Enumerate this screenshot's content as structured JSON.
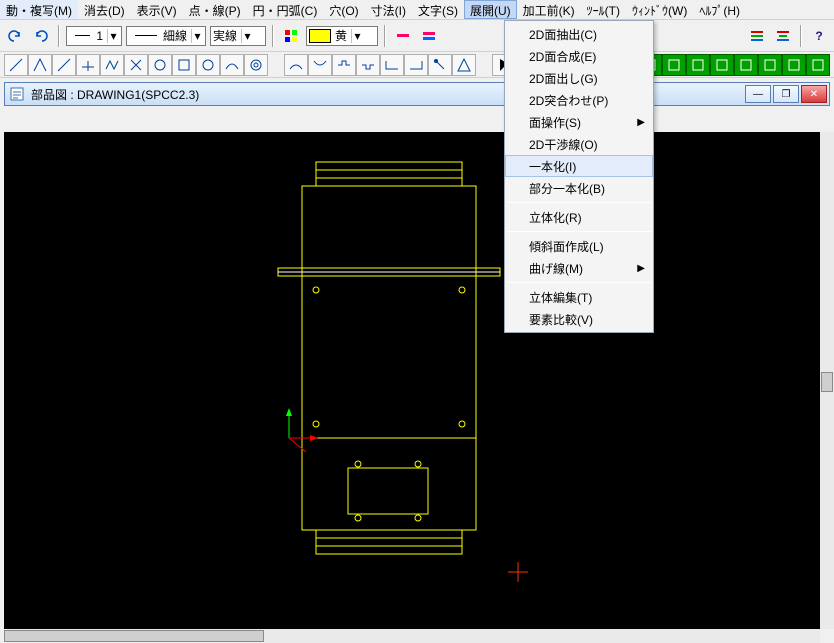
{
  "menubar": [
    {
      "label": "動・複写(M)"
    },
    {
      "label": "消去(D)"
    },
    {
      "label": "表示(V)"
    },
    {
      "label": "点・線(P)"
    },
    {
      "label": "円・円弧(C)"
    },
    {
      "label": "穴(O)"
    },
    {
      "label": "寸法(I)"
    },
    {
      "label": "文字(S)"
    },
    {
      "label": "展開(U)",
      "active": true
    },
    {
      "label": "加工前(K)"
    },
    {
      "label": "ﾂｰﾙ(T)"
    },
    {
      "label": "ｳｨﾝﾄﾞｳ(W)"
    },
    {
      "label": "ﾍﾙﾌﾟ(H)"
    }
  ],
  "toolbar1": {
    "linewidth": "1",
    "linepattern": "細線",
    "linestyle": "実線",
    "color_label": "黄"
  },
  "document": {
    "title": "部品図 : DRAWING1(SPCC2.3)"
  },
  "dropdown": [
    {
      "label": "2D面抽出(C)"
    },
    {
      "label": "2D面合成(E)"
    },
    {
      "label": "2D面出し(G)"
    },
    {
      "label": "2D突合わせ(P)"
    },
    {
      "label": "面操作(S)",
      "submenu": true
    },
    {
      "label": "2D干渉線(O)"
    },
    {
      "label": "一本化(I)",
      "highlight": true
    },
    {
      "label": "部分一本化(B)"
    },
    {
      "sep": true
    },
    {
      "label": "立体化(R)"
    },
    {
      "sep": true
    },
    {
      "label": "傾斜面作成(L)"
    },
    {
      "label": "曲げ線(M)",
      "submenu": true
    },
    {
      "sep": true
    },
    {
      "label": "立体編集(T)"
    },
    {
      "label": "要素比較(V)"
    }
  ]
}
